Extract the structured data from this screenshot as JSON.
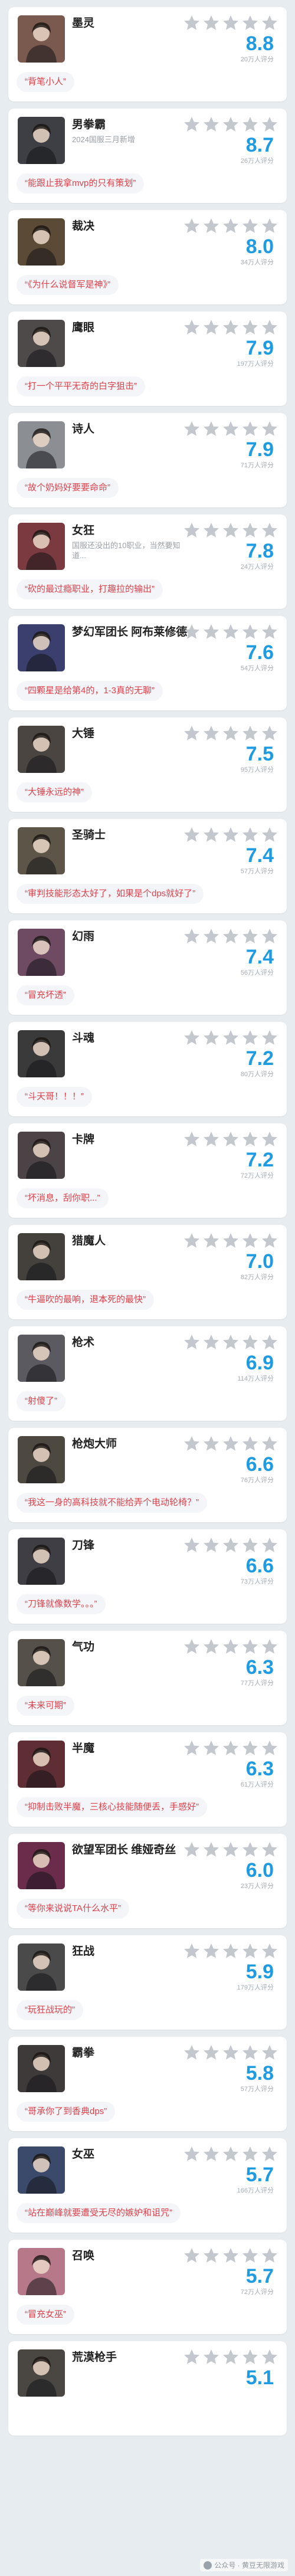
{
  "colors": {
    "score": "#1e9be3",
    "quote_text": "#e0414b",
    "star_gray": "#c3c8ce",
    "star_gold": "#f5b400"
  },
  "items": [
    {
      "name": "墨灵",
      "sub": "",
      "score": "8.8",
      "count": "20万人评分",
      "quote": "“背笔小人”",
      "stars_filled": 0,
      "tone": "#7a5a4e"
    },
    {
      "name": "男拳霸",
      "sub": "2024国服三月新增",
      "score": "8.7",
      "count": "26万人评分",
      "quote": "“能跟止我拿mvp的只有策划”",
      "stars_filled": 0,
      "tone": "#3d3f44"
    },
    {
      "name": "裁决",
      "sub": "",
      "score": "8.0",
      "count": "34万人评分",
      "quote": "“《为什么说督军是神》”",
      "stars_filled": 0,
      "tone": "#5b4a36"
    },
    {
      "name": "鹰眼",
      "sub": "",
      "score": "7.9",
      "count": "197万人评分",
      "quote": "“打一个平平无奇的白字狙击”",
      "stars_filled": 0,
      "tone": "#4e4a4a"
    },
    {
      "name": "诗人",
      "sub": "",
      "score": "7.9",
      "count": "71万人评分",
      "quote": "“故个奶妈好要要命命”",
      "stars_filled": 0,
      "tone": "#8b8f94"
    },
    {
      "name": "女狂",
      "sub": "国服还没出的10职业，当然要知道...",
      "score": "7.8",
      "count": "24万人评分",
      "quote": "“砍的最过瘾职业，打趣拉的输出”",
      "stars_filled": 0,
      "tone": "#7a3a3f"
    },
    {
      "name": "梦幻军团长 阿布莱修德",
      "sub": "",
      "score": "7.6",
      "count": "54万人评分",
      "quote": "“四颗星是给第4的，1-3真的无聊”",
      "stars_filled": 0,
      "tone": "#3b3f6e"
    },
    {
      "name": "大锤",
      "sub": "",
      "score": "7.5",
      "count": "95万人评分",
      "quote": "“大锤永远的神”",
      "stars_filled": 0,
      "tone": "#4a4540"
    },
    {
      "name": "圣骑士",
      "sub": "",
      "score": "7.4",
      "count": "57万人评分",
      "quote": "“审判技能形态太好了，如果是个dps就好了”",
      "stars_filled": 0,
      "tone": "#5d5648"
    },
    {
      "name": "幻雨",
      "sub": "",
      "score": "7.4",
      "count": "56万人评分",
      "quote": "“冒充坏透”",
      "stars_filled": 0,
      "tone": "#6e4a63"
    },
    {
      "name": "斗魂",
      "sub": "",
      "score": "7.2",
      "count": "80万人评分",
      "quote": "“斗天哥！！！”",
      "stars_filled": 0,
      "tone": "#3a3a3a"
    },
    {
      "name": "卡牌",
      "sub": "",
      "score": "7.2",
      "count": "72万人评分",
      "quote": "“坏消息，刮你职...”",
      "stars_filled": 0,
      "tone": "#4b4346"
    },
    {
      "name": "猎魔人",
      "sub": "",
      "score": "7.0",
      "count": "82万人评分",
      "quote": "“牛逼吹的最响，退本死的最快”",
      "stars_filled": 0,
      "tone": "#44403c"
    },
    {
      "name": "枪术",
      "sub": "",
      "score": "6.9",
      "count": "114万人评分",
      "quote": "“射傻了”",
      "stars_filled": 0,
      "tone": "#5a5a60"
    },
    {
      "name": "枪炮大师",
      "sub": "",
      "score": "6.6",
      "count": "76万人评分",
      "quote": "“我这一身的高科技就不能给弄个电动轮椅？”",
      "stars_filled": 0,
      "tone": "#4d4840"
    },
    {
      "name": "刀锋",
      "sub": "",
      "score": "6.6",
      "count": "73万人评分",
      "quote": "“刀锋就像数学。。。”",
      "stars_filled": 0,
      "tone": "#3e3e44"
    },
    {
      "name": "气功",
      "sub": "",
      "score": "6.3",
      "count": "77万人评分",
      "quote": "“未来可期”",
      "stars_filled": 0,
      "tone": "#56504a"
    },
    {
      "name": "半魔",
      "sub": "",
      "score": "6.3",
      "count": "61万人评分",
      "quote": "“抑制击败半魔，三核心技能随便丢，手感好”",
      "stars_filled": 0,
      "tone": "#5e2e34"
    },
    {
      "name": "欲望军团长 维娅奇丝",
      "sub": "",
      "score": "6.0",
      "count": "23万人评分",
      "quote": "“等你来说说TA什么水平”",
      "stars_filled": 0,
      "tone": "#6b2c4c"
    },
    {
      "name": "狂战",
      "sub": "",
      "score": "5.9",
      "count": "179万人评分",
      "quote": "“玩狂战玩的”",
      "stars_filled": 0,
      "tone": "#4a4a4a"
    },
    {
      "name": "霸拳",
      "sub": "",
      "score": "5.8",
      "count": "57万人评分",
      "quote": "“哥承你了到香典dps”",
      "stars_filled": 0,
      "tone": "#3f3a3a"
    },
    {
      "name": "女巫",
      "sub": "",
      "score": "5.7",
      "count": "166万人评分",
      "quote": "“站在巅峰就要遭受无尽的嫉妒和诅咒”",
      "stars_filled": 0,
      "tone": "#3b4a6a"
    },
    {
      "name": "召唤",
      "sub": "",
      "score": "5.7",
      "count": "72万人评分",
      "quote": "“冒充女巫”",
      "stars_filled": 0,
      "tone": "#b7788a"
    },
    {
      "name": "荒漠枪手",
      "sub": "",
      "score": "5.1",
      "count": "",
      "quote": "",
      "stars_filled": 0,
      "tone": "#4a4743"
    }
  ],
  "watermark": "公众号 · 黄豆无限游戏",
  "watermark_icon": "wechat-icon"
}
